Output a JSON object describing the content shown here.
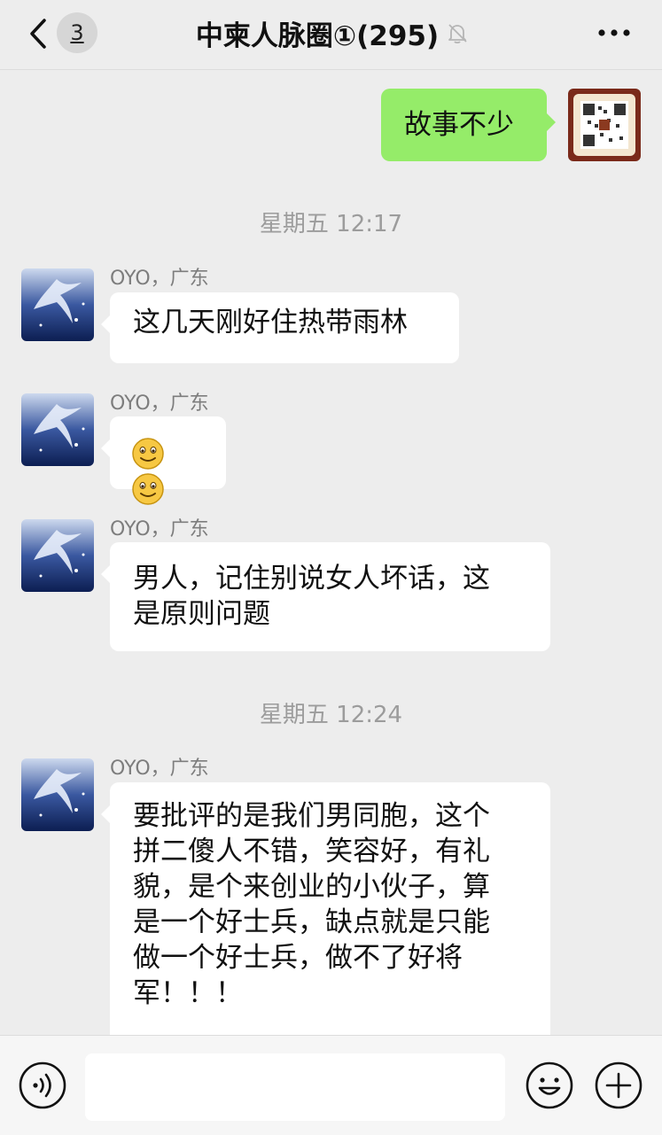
{
  "header": {
    "unread_count": "3",
    "title": "中柬人脉圈①(295)",
    "back_icon": "chevron-left-icon",
    "mute_icon": "bell-off-icon",
    "more_icon": "more-dots-icon"
  },
  "colors": {
    "background": "#ededed",
    "self_bubble": "#95ec69",
    "other_bubble": "#ffffff",
    "timestamp": "#9c9c9c",
    "sender_name": "#7d7d7d"
  },
  "messages": [
    {
      "type": "self",
      "text": "故事不少",
      "avatar": "qr-code-avatar"
    },
    {
      "type": "time",
      "text": "星期五 12:17"
    },
    {
      "type": "other",
      "sender": "OYO，广东",
      "text": "这几天刚好住热带雨林"
    },
    {
      "type": "other",
      "sender": "OYO，广东",
      "emojis": [
        "smile-emoji",
        "smile-emoji"
      ]
    },
    {
      "type": "other",
      "sender": "OYO，广东",
      "lines": [
        "男人，记住别说女人坏话，这",
        "是原则问题"
      ]
    },
    {
      "type": "time",
      "text": "星期五 12:24"
    },
    {
      "type": "other",
      "sender": "OYO，广东",
      "lines": [
        "要批评的是我们男同胞，这个",
        "拼二傻人不错，笑容好，有礼",
        "貌，是个来创业的小伙子，算",
        "是一个好士兵，缺点就是只能",
        "做一个好士兵，做不了好将",
        "军！！！"
      ]
    }
  ],
  "input_bar": {
    "voice_icon": "voice-icon",
    "input_value": "",
    "emoji_icon": "emoji-face-icon",
    "plus_icon": "plus-circle-icon"
  }
}
